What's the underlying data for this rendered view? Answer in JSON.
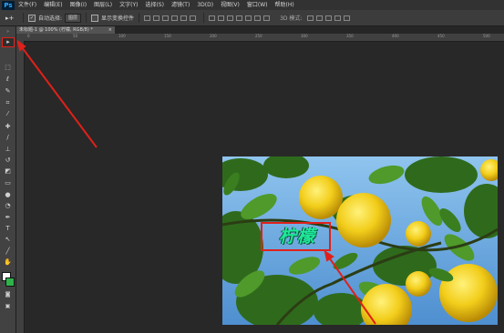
{
  "app": {
    "logo": "Ps"
  },
  "menu": {
    "items": [
      "文件(F)",
      "编辑(E)",
      "图像(I)",
      "图层(L)",
      "文字(Y)",
      "选择(S)",
      "滤镜(T)",
      "3D(D)",
      "视图(V)",
      "窗口(W)",
      "帮助(H)"
    ]
  },
  "options": {
    "tool_glyph": "▸+",
    "auto_select_label": "自动选择:",
    "auto_select_value": "图层",
    "transform_label": "显示变换控件",
    "mode_3d_label": "3D 模式:"
  },
  "document": {
    "tab_title": "未标题-1 @ 100% (柠檬, RGB/8) *",
    "close": "×"
  },
  "ruler": {
    "ticks": [
      "0",
      "50",
      "100",
      "150",
      "200",
      "250",
      "300",
      "350",
      "400",
      "450",
      "500"
    ]
  },
  "tools": [
    {
      "name": "move-tool",
      "glyph": "▸"
    },
    {
      "name": "marquee-tool",
      "glyph": "⬚"
    },
    {
      "name": "lasso-tool",
      "glyph": "ℓ"
    },
    {
      "name": "quick-select-tool",
      "glyph": "✎"
    },
    {
      "name": "crop-tool",
      "glyph": "⌗"
    },
    {
      "name": "eyedropper-tool",
      "glyph": "⁄"
    },
    {
      "name": "healing-tool",
      "glyph": "✚"
    },
    {
      "name": "brush-tool",
      "glyph": "∕"
    },
    {
      "name": "stamp-tool",
      "glyph": "⊥"
    },
    {
      "name": "history-brush-tool",
      "glyph": "↺"
    },
    {
      "name": "eraser-tool",
      "glyph": "◩"
    },
    {
      "name": "gradient-tool",
      "glyph": "▭"
    },
    {
      "name": "blur-tool",
      "glyph": "●"
    },
    {
      "name": "dodge-tool",
      "glyph": "◔"
    },
    {
      "name": "pen-tool",
      "glyph": "✒"
    },
    {
      "name": "type-tool",
      "glyph": "T"
    },
    {
      "name": "path-select-tool",
      "glyph": "↖"
    },
    {
      "name": "line-tool",
      "glyph": "╱"
    },
    {
      "name": "hand-tool",
      "glyph": "✋"
    },
    {
      "name": "zoom-tool",
      "glyph": "⌕"
    },
    {
      "name": "more-tools",
      "glyph": "…"
    }
  ],
  "canvas": {
    "overlay_text": "柠檬"
  },
  "colors": {
    "accent_red": "#e0201a",
    "text_green": "#1fe89a",
    "foreground": "#ffffff",
    "background": "#2db34a"
  }
}
